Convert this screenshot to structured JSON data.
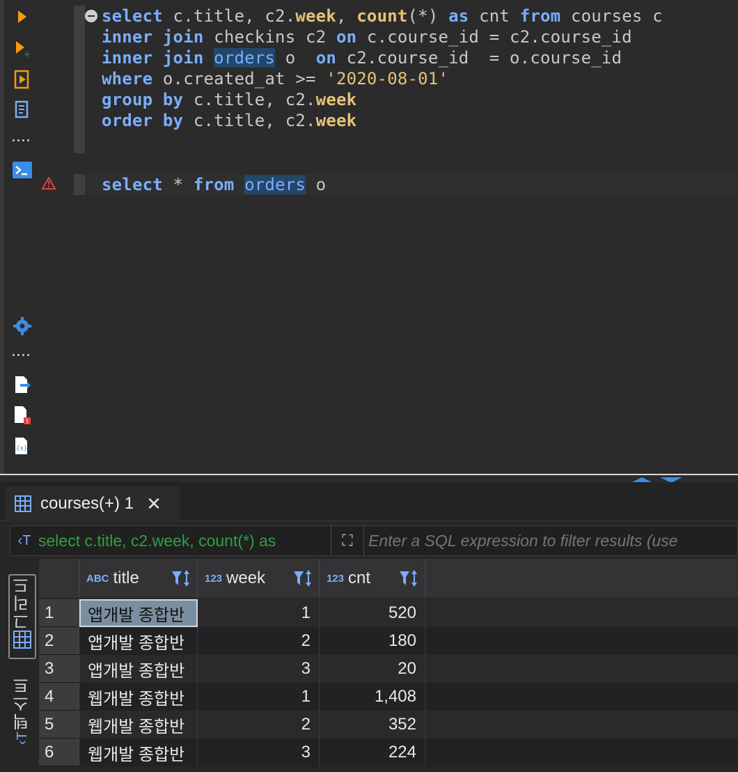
{
  "editor": {
    "query1": {
      "line1": {
        "k1": "select",
        "t1": " c.title, c2.",
        "f1": "week",
        "t2": ", ",
        "f2": "count",
        "t3": "(*) ",
        "k2": "as",
        "t4": " cnt ",
        "k3": "from",
        "t5": " courses c"
      },
      "line2": {
        "k1": "inner",
        "t1": " ",
        "k2": "join",
        "t2": " checkins c2 ",
        "k3": "on",
        "t3": " c.course_id = c2.course_id"
      },
      "line3": {
        "k1": "inner",
        "t1": " ",
        "k2": "join",
        "t2": " ",
        "tb": "orders",
        "t3": " o  ",
        "k3": "on",
        "t4": " c2.course_id  = o.course_id"
      },
      "line4": {
        "k1": "where",
        "t1": " o.created_at >= ",
        "s1": "'2020-08-01'"
      },
      "line5": {
        "k1": "group",
        "t1": " ",
        "k2": "by",
        "t2": " c.title, c2.",
        "f1": "week"
      },
      "line6": {
        "k1": "order",
        "t1": " ",
        "k2": "by",
        "t2": " c.title, c2.",
        "f1": "week"
      }
    },
    "query2": {
      "k1": "select",
      "t1": " * ",
      "k2": "from",
      "t2": " ",
      "tb": "orders",
      "t3": " o"
    }
  },
  "results": {
    "tab_label": "courses(+) 1",
    "tab_close": "✕",
    "filter_query": "select c.title, c2.week, count(*) as",
    "filter_placeholder": "Enter a SQL expression to filter results (use",
    "vtab_grid": "그리드",
    "vtab_text": "텍스트",
    "columns": [
      {
        "type": "ABC",
        "name": "title"
      },
      {
        "type": "123",
        "name": "week"
      },
      {
        "type": "123",
        "name": "cnt"
      }
    ],
    "rows": [
      {
        "n": "1",
        "title": "앱개발 종합반",
        "week": "1",
        "cnt": "520"
      },
      {
        "n": "2",
        "title": "앱개발 종합반",
        "week": "2",
        "cnt": "180"
      },
      {
        "n": "3",
        "title": "앱개발 종합반",
        "week": "3",
        "cnt": "20"
      },
      {
        "n": "4",
        "title": "웹개발 종합반",
        "week": "1",
        "cnt": "1,408"
      },
      {
        "n": "5",
        "title": "웹개발 종합반",
        "week": "2",
        "cnt": "352"
      },
      {
        "n": "6",
        "title": "웹개발 종합반",
        "week": "3",
        "cnt": "224"
      }
    ]
  },
  "colors": {
    "accent": "#7aaefc",
    "keyword": "#7aaefc",
    "function": "#e7c277",
    "run_orange": "#f39c12"
  },
  "icons": [
    "run-icon",
    "run-new-tab-icon",
    "execute-script-icon",
    "explain-plan-icon",
    "terminal-icon",
    "settings-icon",
    "export-icon",
    "error-log-icon",
    "variables-icon",
    "warning-icon"
  ]
}
